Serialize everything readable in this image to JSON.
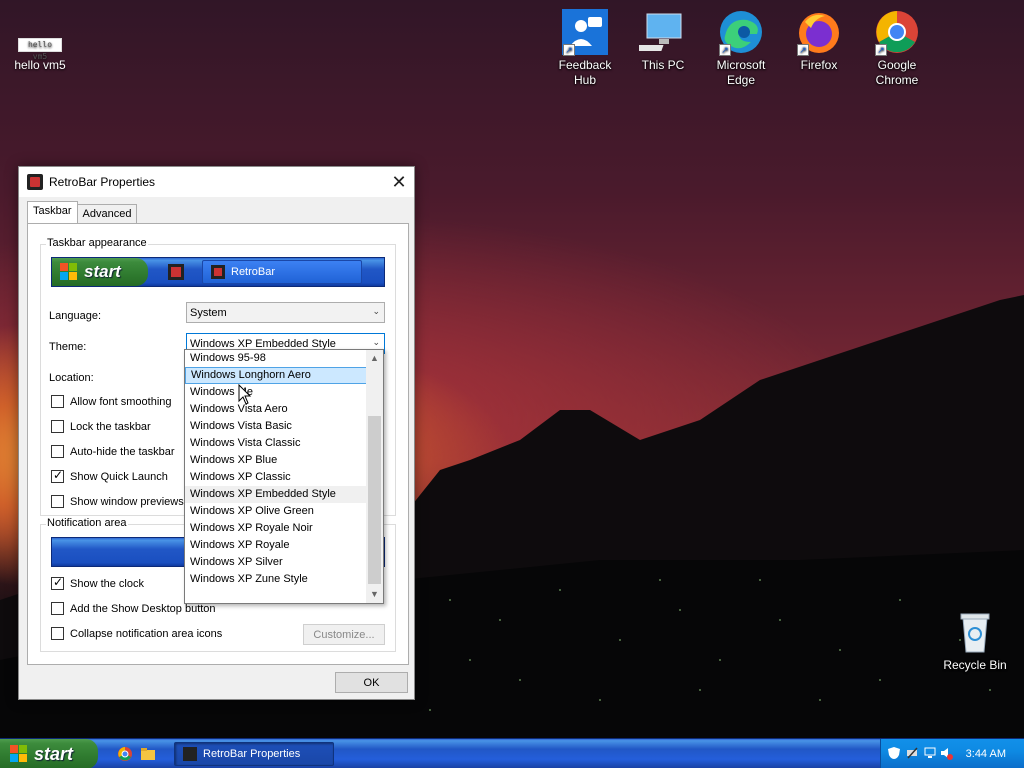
{
  "desktop": {
    "hello_label": "hello vm5",
    "icons": [
      {
        "label": "Feedback Hub",
        "icon": "feedback-hub-icon"
      },
      {
        "label": "This PC",
        "icon": "this-pc-icon"
      },
      {
        "label": "Microsoft Edge",
        "icon": "edge-icon"
      },
      {
        "label": "Firefox",
        "icon": "firefox-icon"
      },
      {
        "label": "Google Chrome",
        "icon": "chrome-icon"
      }
    ],
    "recycle_bin": "Recycle Bin"
  },
  "dialog": {
    "title": "RetroBar Properties",
    "close_glyph": "✕",
    "tabs": [
      {
        "label": "Taskbar"
      },
      {
        "label": "Advanced"
      }
    ],
    "appearance_legend": "Taskbar appearance",
    "preview": {
      "start_label": "start",
      "task_label": "RetroBar"
    },
    "language_label": "Language:",
    "language_value": "System",
    "theme_label": "Theme:",
    "theme_value": "Windows XP Embedded Style",
    "location_label": "Location:",
    "checkboxes": [
      {
        "label": "Allow font smoothing",
        "checked": false
      },
      {
        "label": "Lock the taskbar",
        "checked": false
      },
      {
        "label": "Auto-hide the taskbar",
        "checked": false
      },
      {
        "label": "Show Quick Launch",
        "checked": true
      },
      {
        "label": "Show window previews",
        "checked": false
      }
    ],
    "notification_legend": "Notification area",
    "notif_checkboxes": [
      {
        "label": "Show the clock",
        "checked": true
      },
      {
        "label": "Add the Show Desktop button",
        "checked": false
      },
      {
        "label": "Collapse notification area icons",
        "checked": false
      }
    ],
    "customize_label": "Customize...",
    "ok_label": "OK"
  },
  "theme_dropdown": {
    "items": [
      "Windows 95-98",
      "Windows Longhorn Aero",
      "Windows Me",
      "Windows Vista Aero",
      "Windows Vista Basic",
      "Windows Vista Classic",
      "Windows XP Blue",
      "Windows XP Classic",
      "Windows XP Embedded Style",
      "Windows XP Olive Green",
      "Windows XP Royale Noir",
      "Windows XP Royale",
      "Windows XP Silver",
      "Windows XP Zune Style"
    ],
    "hovered_index": 1,
    "current_index": 8
  },
  "taskbar": {
    "start_label": "start",
    "task_label": "RetroBar Properties",
    "clock": "3:44 AM"
  },
  "colors": {
    "xp_blue": "#245edb",
    "start_green": "#3c8b3c",
    "selection": "#cce8ff"
  }
}
